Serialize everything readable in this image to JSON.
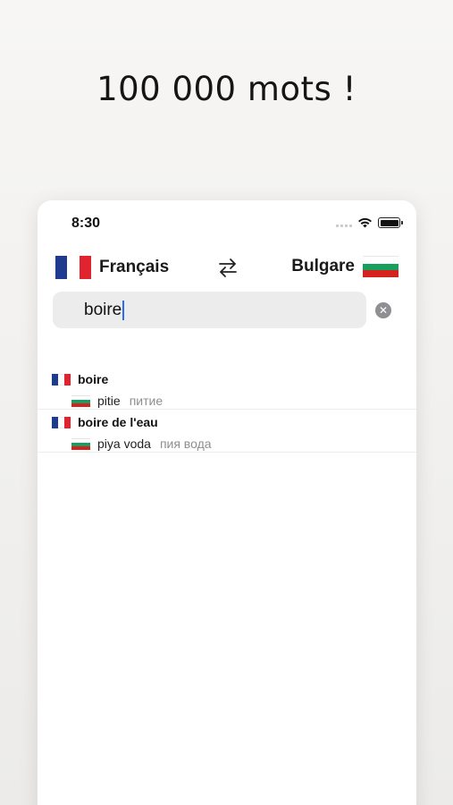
{
  "headline": "100 000 mots !",
  "status": {
    "time": "8:30"
  },
  "languages": {
    "source": {
      "name": "Français",
      "flag": "france-flag"
    },
    "target": {
      "name": "Bulgare",
      "flag": "bulgaria-flag"
    }
  },
  "search": {
    "value": "boire"
  },
  "results": [
    {
      "term": "boire",
      "translation": "pitie",
      "cyrillic": "питие"
    },
    {
      "term": "boire de l'eau",
      "translation": "piya voda",
      "cyrillic": "пия вода"
    }
  ],
  "colors": {
    "france_blue": "#1f3b8f",
    "france_red": "#e0232f",
    "bulgaria_green": "#17a05d",
    "bulgaria_red": "#d4221e",
    "cursor_blue": "#2c6df5"
  }
}
